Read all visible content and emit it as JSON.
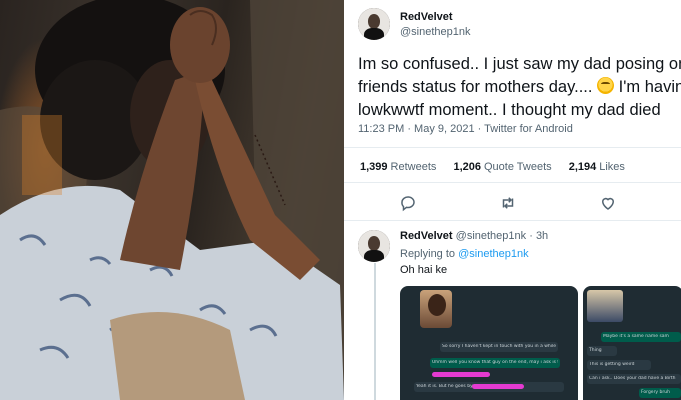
{
  "tweet": {
    "author_name": "RedVelvet",
    "author_handle": "@sinethep1nk",
    "text_lines": [
      "Im so confused.. I just saw my dad posing on",
      "friends status for mothers day....",
      "I'm havin",
      "lowkwwtf moment.. I thought my dad died"
    ],
    "emoji": "thinking-face-emoji",
    "timestamp": "11:23 PM · May 9, 2021 · Twitter for Android",
    "stats": {
      "retweets_count": "1,399",
      "retweets_label": "Retweets",
      "quotes_count": "1,206",
      "quotes_label": "Quote Tweets",
      "likes_count": "2,194",
      "likes_label": "Likes"
    },
    "actions": [
      "reply-icon",
      "retweet-icon",
      "like-icon"
    ]
  },
  "reply": {
    "author_name": "RedVelvet",
    "author_handle": "@sinethep1nk",
    "time_ago": "· 3h",
    "replying_prefix": "Replying to",
    "replying_to": "@sinethep1nk",
    "text": "Oh hai ke"
  },
  "chat_a": {
    "lines": [
      "So sorry I haven't kept in touch with you in a while",
      "Uhmm well you know that guy on the end, may i ask is that",
      "Yeah it is. But he goes by"
    ]
  },
  "chat_b": {
    "lines": [
      "Maybe it's a same name sam",
      "Thing",
      "This is getting weird",
      "Can i ask.. Does your dad have a Birth",
      "Forgery bruh"
    ]
  },
  "colors": {
    "accent": "#1d9bf0",
    "text": "#0f1419",
    "muted": "#536471",
    "chat_bg": "#1f2c33",
    "chat_out": "#005c4b"
  }
}
